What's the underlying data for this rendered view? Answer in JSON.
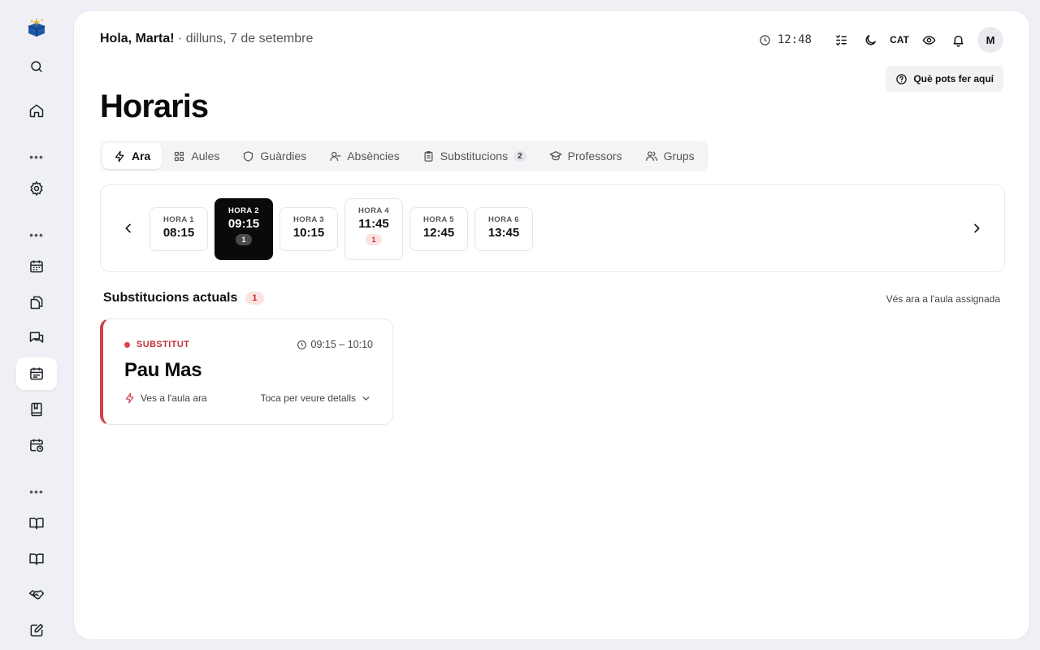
{
  "header": {
    "greeting_name": "Hola, Marta!",
    "greeting_date": "· dilluns, 7 de setembre",
    "clock": "12:48",
    "language": "CAT",
    "avatar_initial": "M",
    "help_label": "Què pots fer aquí"
  },
  "page": {
    "title": "Horaris"
  },
  "tabs": [
    {
      "label": "Ara",
      "icon": "bolt-icon",
      "active": true
    },
    {
      "label": "Aules",
      "icon": "grid-icon"
    },
    {
      "label": "Guàrdies",
      "icon": "shield-icon"
    },
    {
      "label": "Absències",
      "icon": "user-minus-icon"
    },
    {
      "label": "Substitucions",
      "icon": "clipboard-icon",
      "count": "2"
    },
    {
      "label": "Professors",
      "icon": "graduation-cap-icon"
    },
    {
      "label": "Grups",
      "icon": "users-icon"
    }
  ],
  "hours": [
    {
      "label": "HORA 1",
      "time": "08:15"
    },
    {
      "label": "HORA 2",
      "time": "09:15",
      "badge": "1",
      "active": true
    },
    {
      "label": "HORA 3",
      "time": "10:15"
    },
    {
      "label": "HORA 4",
      "time": "11:45",
      "badge": "1",
      "alert": true
    },
    {
      "label": "HORA 5",
      "time": "12:45"
    },
    {
      "label": "HORA 6",
      "time": "13:45"
    }
  ],
  "substitutions": {
    "title": "Substitucions actuals",
    "count": "1",
    "link": "Vés ara a l'aula assignada",
    "cards": [
      {
        "role": "SUBSTITUT",
        "time": "09:15 – 10:10",
        "name": "Pau Mas",
        "action": "Ves a l'aula ara",
        "details": "Toca per veure detalls"
      }
    ]
  },
  "colors": {
    "accent_red": "#d0414a",
    "active_hour": "#0a0a0a",
    "background": "#eef0f5"
  }
}
